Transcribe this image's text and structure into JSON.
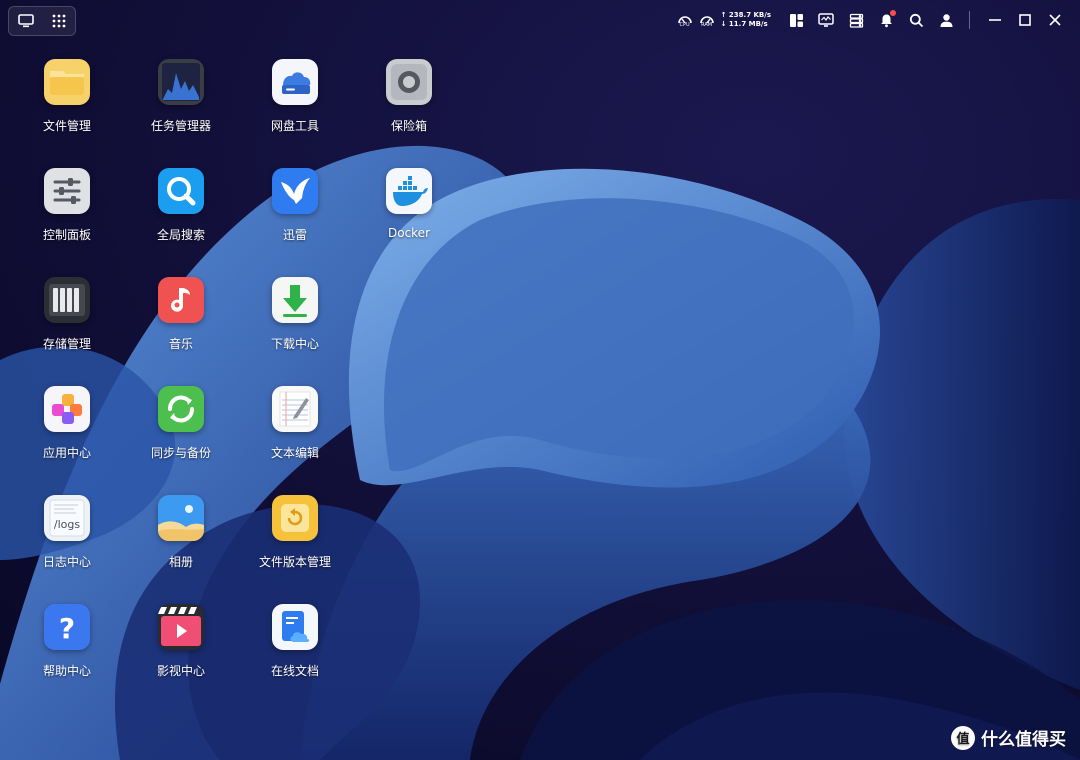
{
  "topbar": {
    "cpu_label": "CPU",
    "ram_label": "RAM",
    "upload_speed": "↑ 238.7 KB/s",
    "download_speed": "↓ 11.7 MB/s"
  },
  "apps": [
    {
      "label": "文件管理",
      "icon": "folder-icon"
    },
    {
      "label": "任务管理器",
      "icon": "activity-chart-icon"
    },
    {
      "label": "网盘工具",
      "icon": "cloud-drive-icon"
    },
    {
      "label": "保险箱",
      "icon": "safe-icon"
    },
    {
      "label": "控制面板",
      "icon": "sliders-icon"
    },
    {
      "label": "全局搜索",
      "icon": "search-icon"
    },
    {
      "label": "迅雷",
      "icon": "bird-icon"
    },
    {
      "label": "Docker",
      "icon": "docker-whale-icon"
    },
    {
      "label": "存储管理",
      "icon": "storage-drives-icon"
    },
    {
      "label": "音乐",
      "icon": "music-note-icon"
    },
    {
      "label": "下载中心",
      "icon": "download-arrow-icon"
    },
    {
      "label": "应用中心",
      "icon": "app-blocks-icon"
    },
    {
      "label": "同步与备份",
      "icon": "sync-icon"
    },
    {
      "label": "文本编辑",
      "icon": "notepad-pen-icon"
    },
    {
      "label": "日志中心",
      "icon": "logs-icon",
      "icon_text": "/logs"
    },
    {
      "label": "相册",
      "icon": "photo-landscape-icon"
    },
    {
      "label": "文件版本管理",
      "icon": "file-version-icon"
    },
    {
      "label": "帮助中心",
      "icon": "help-question-icon",
      "icon_text": "?"
    },
    {
      "label": "影视中心",
      "icon": "video-clapper-icon"
    },
    {
      "label": "在线文档",
      "icon": "online-document-icon"
    }
  ],
  "watermark": {
    "symbol": "值",
    "text": "什么值得买"
  },
  "colors": {
    "background": "#0d0b2e",
    "wallpaper_blue": "#3e6fc0",
    "notification_dot": "#ff4d4d"
  }
}
